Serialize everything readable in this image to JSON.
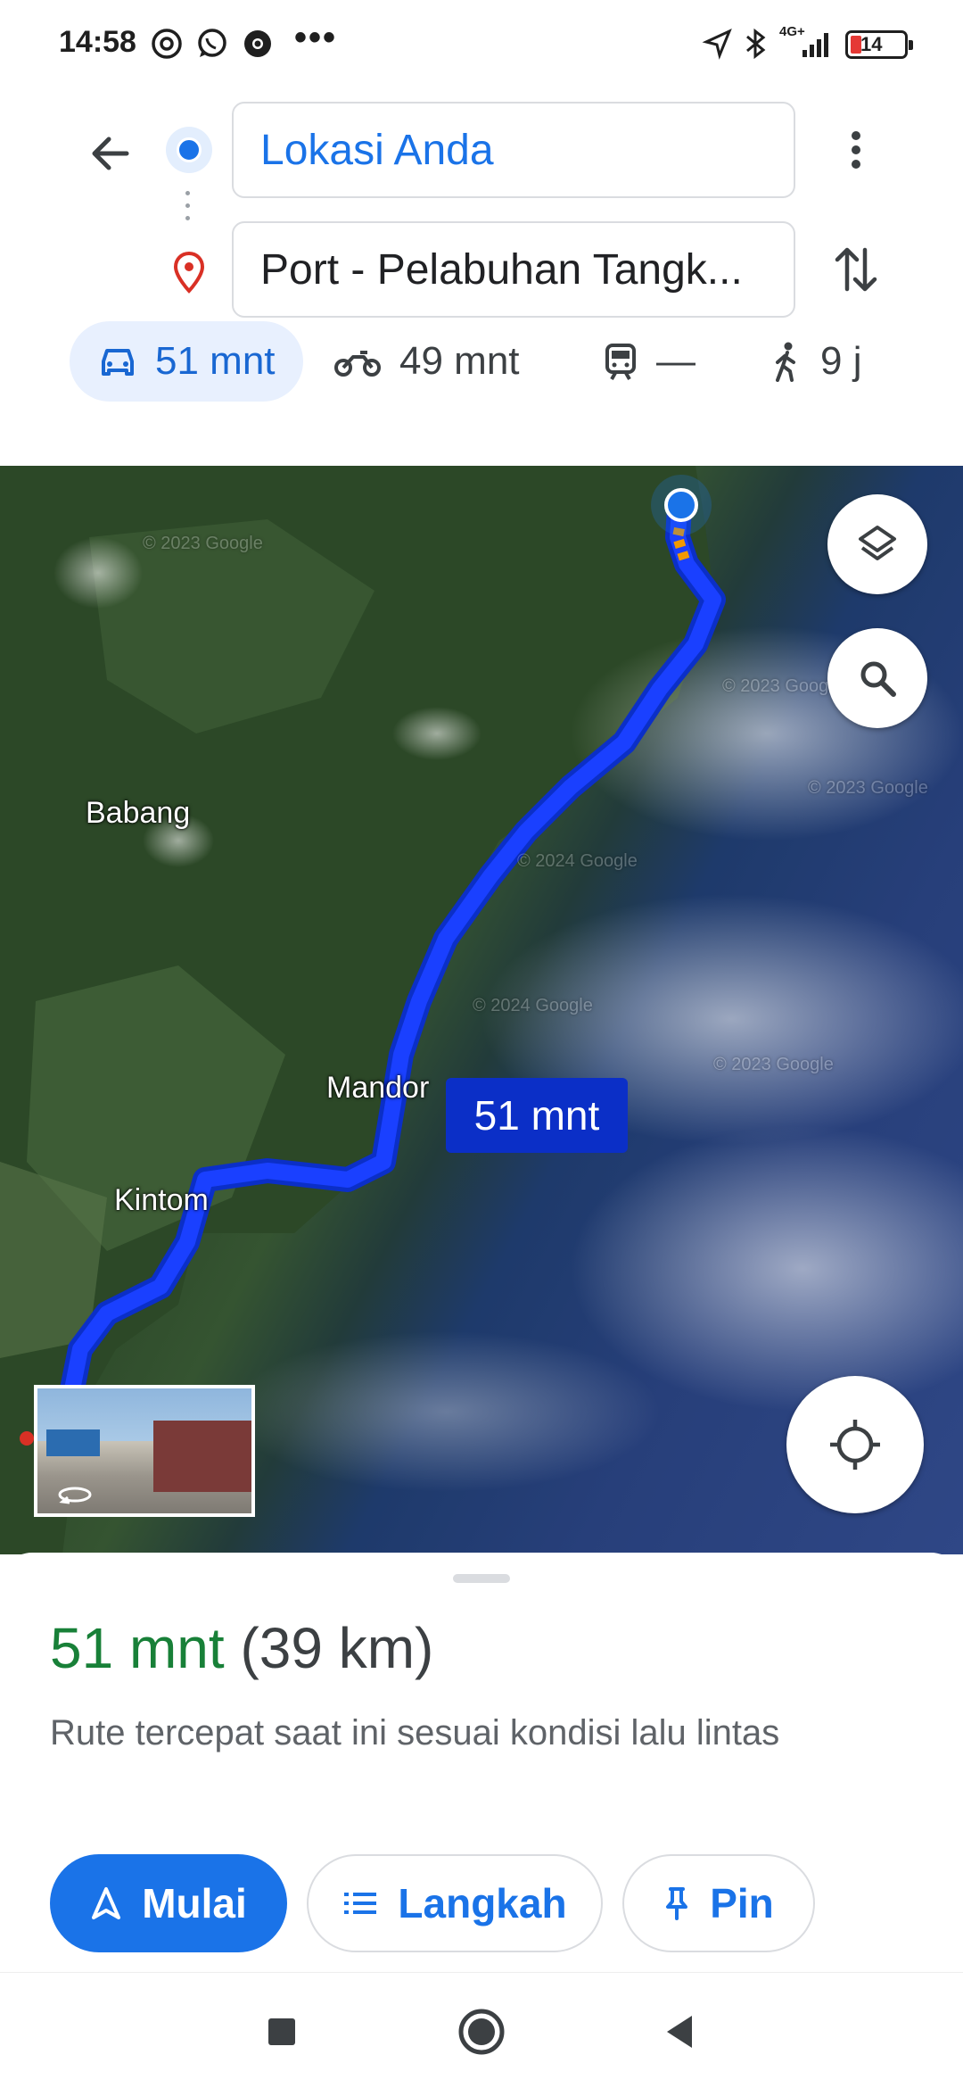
{
  "status_bar": {
    "time": "14:58",
    "battery": "14",
    "network": "4G+",
    "icons": [
      "threads-icon",
      "whatsapp-icon",
      "chrome-icon",
      "more-dots-icon",
      "location-arrow-icon",
      "bluetooth-icon",
      "signal-icon",
      "battery-icon"
    ]
  },
  "directions": {
    "origin_value": "Lokasi Anda",
    "destination_value": "Port - Pelabuhan Tangk...",
    "accent_color": "#1a73e8"
  },
  "modes": [
    {
      "name": "car",
      "label": "51 mnt",
      "active": true
    },
    {
      "name": "motorcycle",
      "label": "49 mnt",
      "active": false
    },
    {
      "name": "transit",
      "label": "—",
      "active": false
    },
    {
      "name": "walk",
      "label": "9 j",
      "active": false
    }
  ],
  "map": {
    "labels": {
      "babang": "Babang",
      "mandor": "Mandor",
      "kintom": "Kintom"
    },
    "route_badge": "51 mnt",
    "watermarks": [
      "© 2023 Google",
      "© 2023 Google",
      "© 2023 Google",
      "© 2024 Google",
      "© 2024 Google",
      "© 2023 Google"
    ],
    "route_color": "#1a40ff"
  },
  "sheet": {
    "duration": "51 mnt",
    "distance": "(39 km)",
    "description": "Rute tercepat saat ini sesuai kondisi lalu lintas",
    "buttons": {
      "start": "Mulai",
      "steps": "Langkah",
      "pin": "Pin"
    },
    "duration_color": "#188038"
  }
}
